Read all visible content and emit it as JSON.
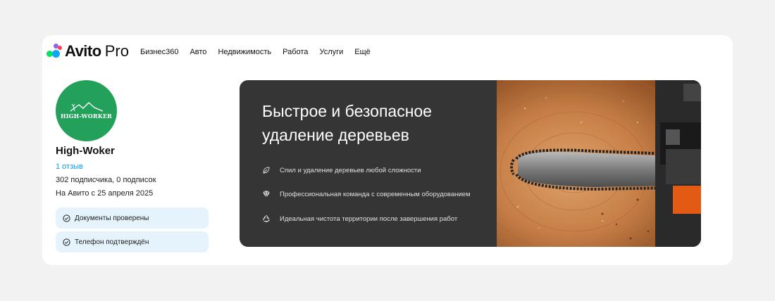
{
  "header": {
    "logo_text": "Avito",
    "logo_suffix": "Pro",
    "nav": [
      {
        "label": "Бизнес360"
      },
      {
        "label": "Авто"
      },
      {
        "label": "Недвижимость"
      },
      {
        "label": "Работа"
      },
      {
        "label": "Услуги"
      },
      {
        "label": "Ещё"
      }
    ]
  },
  "profile": {
    "avatar_text": "HIGH-WORKER",
    "name": "High-Woker",
    "reviews": "1 отзыв",
    "subscriptions": "302 подписчика, 0 подписок",
    "since": "На Авито с 25 апреля 2025",
    "badges": [
      {
        "label": "Документы проверены"
      },
      {
        "label": "Телефон подтверждён"
      }
    ]
  },
  "banner": {
    "title": "Быстрое и безопасное удаление деревьев",
    "features": [
      {
        "label": "Спил и удаление деревьев любой сложности",
        "icon": "leaf-icon"
      },
      {
        "label": "Профессиональная команда с современным оборудованием",
        "icon": "diamond-icon"
      },
      {
        "label": "Идеальная чистота территории после завершения работ",
        "icon": "recycle-icon"
      }
    ]
  },
  "colors": {
    "accent_link": "#0a9cf5",
    "badge_bg": "#e5f3fd",
    "banner_bg": "#353535",
    "avatar_bg": "#23a15a"
  }
}
